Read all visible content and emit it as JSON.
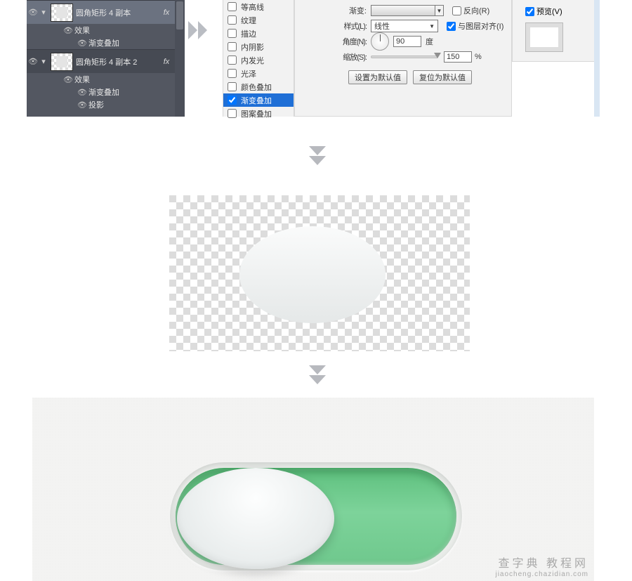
{
  "layers": {
    "rows": [
      {
        "name": "圆角矩形 4 副本",
        "fx": "fx"
      },
      {
        "name": "效果"
      },
      {
        "name": "渐变叠加"
      },
      {
        "name": "圆角矩形 4 副本 2",
        "fx": "fx"
      },
      {
        "name": "效果"
      },
      {
        "name": "渐变叠加"
      },
      {
        "name": "投影"
      }
    ]
  },
  "styles": {
    "items": [
      "等高线",
      "纹理",
      "描边",
      "内阴影",
      "内发光",
      "光泽",
      "颜色叠加",
      "渐变叠加",
      "图案叠加"
    ],
    "selected_index": 7
  },
  "dlg": {
    "gradient_label": "渐变:",
    "reverse_label": "反向(R)",
    "style_label": "样式(L):",
    "style_value": "线性",
    "align_label": "与图层对齐(I)",
    "angle_label": "角度(N):",
    "angle_value": "90",
    "angle_unit": "度",
    "scale_label": "缩放(S):",
    "scale_value": "150",
    "scale_unit": "%",
    "btn_default": "设置为默认值",
    "btn_reset": "复位为默认值"
  },
  "preview": {
    "label": "预览(V)"
  },
  "watermark": {
    "l1": "查字典 教程网",
    "l2": "jiaocheng.chazidian.com"
  }
}
